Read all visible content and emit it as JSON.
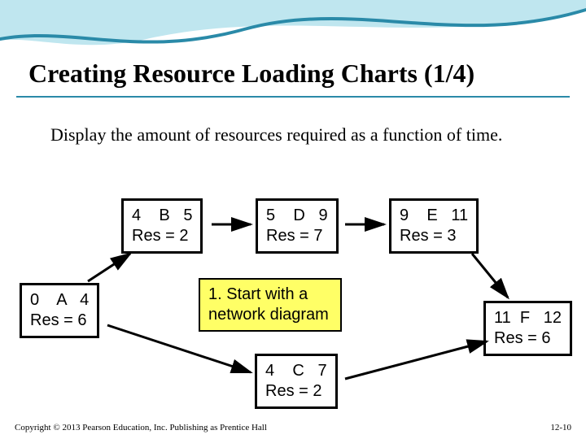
{
  "title": "Creating Resource Loading Charts (1/4)",
  "subtitle": "Display the amount of resources required as a function of time.",
  "nodes": {
    "A": {
      "line1": "0    A   4",
      "line2": "Res = 6"
    },
    "B": {
      "line1": "4    B   5",
      "line2": "Res = 2"
    },
    "C": {
      "line1": "4    C   7",
      "line2": "Res = 2"
    },
    "D": {
      "line1": "5    D   9",
      "line2": "Res = 7"
    },
    "E": {
      "line1": "9    E   11",
      "line2": "Res = 3"
    },
    "F": {
      "line1": "11  F   12",
      "line2": "Res = 6"
    }
  },
  "callout": {
    "line1": "1. Start with a",
    "line2": "    network diagram"
  },
  "copyright": "Copyright © 2013 Pearson Education, Inc. Publishing as Prentice Hall",
  "pagenum": "12-10"
}
